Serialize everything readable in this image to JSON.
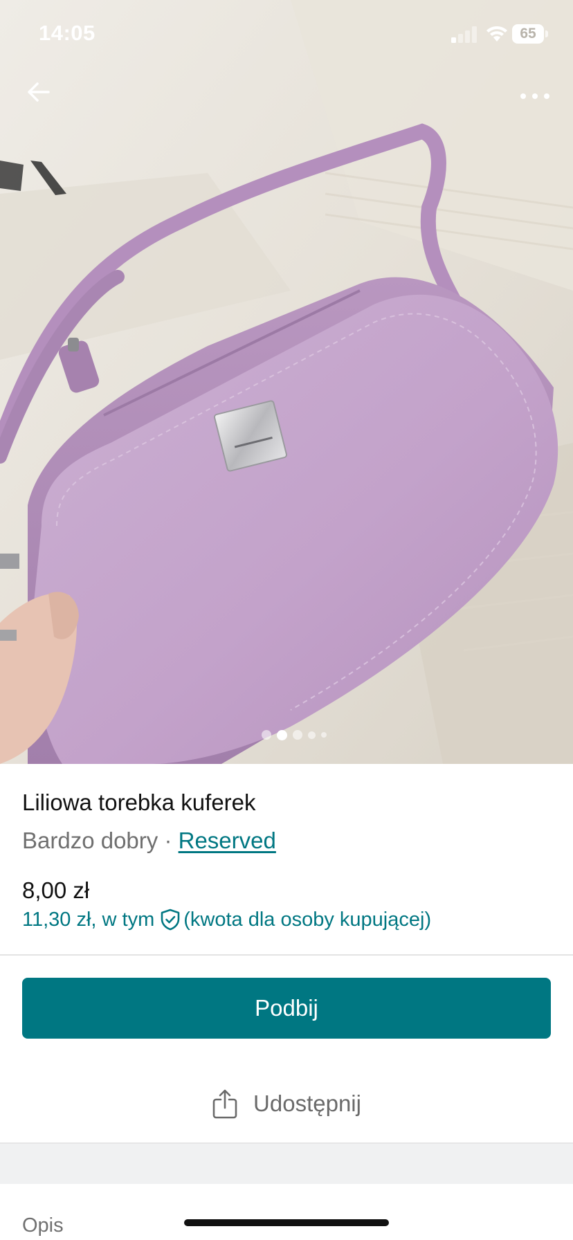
{
  "status_bar": {
    "time": "14:05",
    "battery": "65",
    "icons": [
      "signal-icon",
      "wifi-icon",
      "battery-icon"
    ]
  },
  "header": {
    "back_icon": "arrow-left-icon",
    "more_icon": "more-horizontal-icon"
  },
  "gallery": {
    "image_count": 5,
    "active_index": 1
  },
  "item": {
    "title": "Liliowa torebka kuferek",
    "condition": "Bardzo dobry",
    "separator": "·",
    "brand": "Reserved",
    "price": "8,00 zł",
    "price_total": "11,30 zł, w tym",
    "buyer_protection_note": "(kwota dla osoby kupującej)"
  },
  "actions": {
    "bump_label": "Podbij",
    "share_label": "Udostępnij"
  },
  "description": {
    "label": "Opis"
  },
  "colors": {
    "accent": "#007782",
    "photo_bag": "#c4a3cb",
    "background": "#ffffff"
  }
}
